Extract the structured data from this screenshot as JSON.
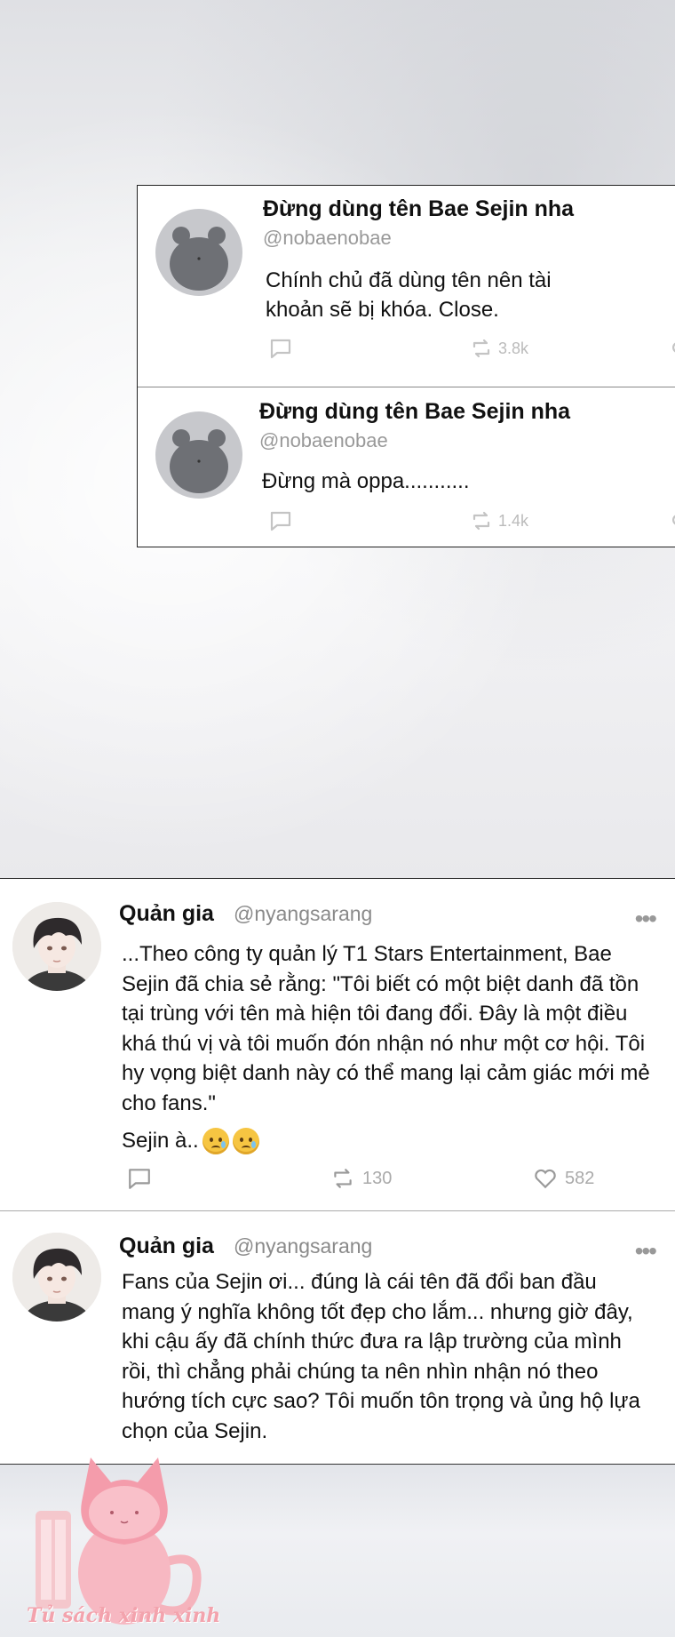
{
  "embedded_tweets": [
    {
      "name": "Đừng dùng tên Bae Sejin nha",
      "handle": "@nobaenobae",
      "text": "Chính chủ đã dùng tên nên tài khoản sẽ bị khóa. Close.",
      "retweets": "3.8k"
    },
    {
      "name": "Đừng dùng tên Bae Sejin nha",
      "handle": "@nobaenobae",
      "text": "Đừng mà oppa...........",
      "retweets": "1.4k"
    }
  ],
  "tweets": [
    {
      "name": "Quản gia",
      "handle": "@nyangsarang",
      "text": "...Theo công ty quản lý T1 Stars Entertainment, Bae Sejin đã chia sẻ rằng: \"Tôi biết có một biệt danh đã tồn tại trùng với tên mà hiện tôi đang đổi. Đây là một điều khá thú vị và tôi muốn đón nhận nó như một cơ hội. Tôi hy vọng biệt danh này có thể mang lại cảm giác mới mẻ cho fans.\"",
      "text2": "Sejin à..",
      "retweets": "130",
      "likes": "582"
    },
    {
      "name": "Quản gia",
      "handle": "@nyangsarang",
      "text": "Fans của Sejin ơi... đúng là cái tên đã đổi ban đầu mang ý nghĩa không tốt đẹp cho lắm... nhưng giờ đây, khi cậu ấy đã chính thức đưa ra lập trường của mình rồi, thì chẳng phải chúng ta nên nhìn nhận nó theo hướng tích cực sao? Tôi muốn tôn trọng và ủng hộ lựa chọn của Sejin."
    }
  ],
  "watermark": "Tủ sách xinh xinh",
  "icons": {
    "reply": "reply-icon",
    "retweet": "retweet-icon",
    "like": "heart-icon",
    "more": "more-icon",
    "emoji": "crying-face-emoji"
  },
  "colors": {
    "watermark_pink": "#f3a3ad",
    "action_gray": "#aaaaaa",
    "handle_gray": "#999999"
  }
}
